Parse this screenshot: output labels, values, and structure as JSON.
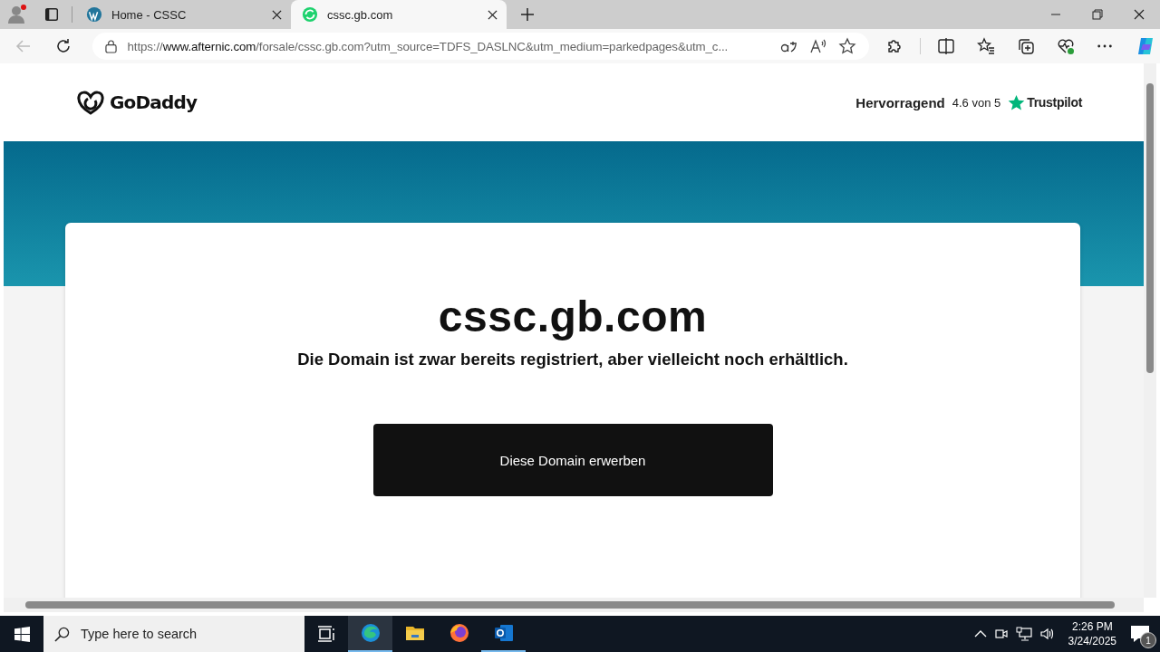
{
  "browser": {
    "tabs": [
      {
        "title": "Home - CSSC",
        "kind": "wordpress",
        "selected": false
      },
      {
        "title": "cssc.gb.com",
        "kind": "site",
        "selected": true
      }
    ],
    "address": {
      "scheme": "https://",
      "host": "www.afternic.com",
      "path": "/forsale/cssc.gb.com?utm_source=TDFS_DASLNC&utm_medium=parkedpages&utm_c..."
    }
  },
  "page": {
    "logo": "GoDaddy",
    "rating": {
      "label": "Hervorragend",
      "score": "4.6 von 5",
      "brand": "Trustpilot"
    },
    "domain": "cssc.gb.com",
    "message": "Die Domain ist zwar bereits registriert, aber vielleicht noch erhältlich.",
    "button": "Diese Domain erwerben"
  },
  "taskbar": {
    "search_placeholder": "Type here to search",
    "apps": [
      {
        "kind": "edge",
        "selected": true,
        "running": true
      },
      {
        "kind": "folder",
        "selected": false,
        "running": false
      },
      {
        "kind": "firefox",
        "selected": false,
        "running": false
      },
      {
        "kind": "outlook",
        "selected": false,
        "running": true
      }
    ],
    "time": "2:26 PM",
    "date": "3/24/2025",
    "notifications": "1"
  }
}
